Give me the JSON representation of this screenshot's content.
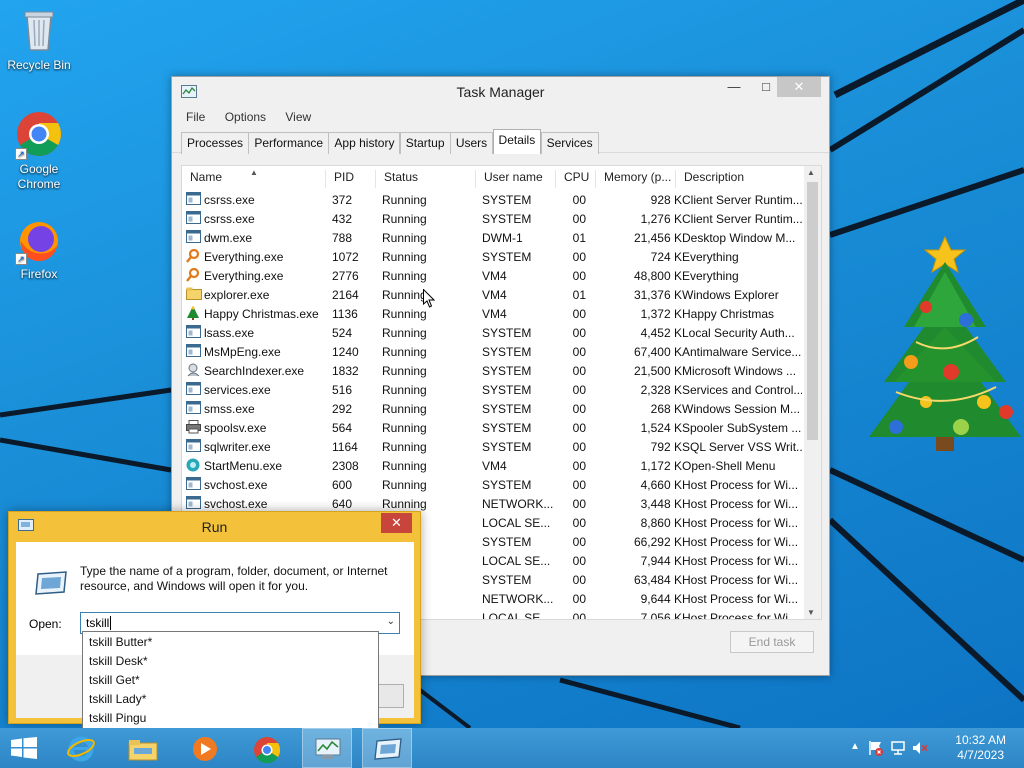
{
  "desktop": {
    "icons": [
      {
        "label": "Recycle Bin",
        "icon": "recycle-bin-icon"
      },
      {
        "label": "Google Chrome",
        "icon": "chrome-icon"
      },
      {
        "label": "Firefox",
        "icon": "firefox-icon"
      }
    ]
  },
  "task_manager": {
    "title": "Task Manager",
    "menu": [
      "File",
      "Options",
      "View"
    ],
    "tabs": [
      "Processes",
      "Performance",
      "App history",
      "Startup",
      "Users",
      "Details",
      "Services"
    ],
    "active_tab": "Details",
    "columns": [
      "Name",
      "PID",
      "Status",
      "User name",
      "CPU",
      "Memory (p...",
      "Description"
    ],
    "rows": [
      {
        "name": "csrss.exe",
        "pid": "372",
        "status": "Running",
        "user": "SYSTEM",
        "cpu": "00",
        "mem": "928 K",
        "desc": "Client Server Runtim..."
      },
      {
        "name": "csrss.exe",
        "pid": "432",
        "status": "Running",
        "user": "SYSTEM",
        "cpu": "00",
        "mem": "1,276 K",
        "desc": "Client Server Runtim..."
      },
      {
        "name": "dwm.exe",
        "pid": "788",
        "status": "Running",
        "user": "DWM-1",
        "cpu": "01",
        "mem": "21,456 K",
        "desc": "Desktop Window M..."
      },
      {
        "name": "Everything.exe",
        "pid": "1072",
        "status": "Running",
        "user": "SYSTEM",
        "cpu": "00",
        "mem": "724 K",
        "desc": "Everything"
      },
      {
        "name": "Everything.exe",
        "pid": "2776",
        "status": "Running",
        "user": "VM4",
        "cpu": "00",
        "mem": "48,800 K",
        "desc": "Everything"
      },
      {
        "name": "explorer.exe",
        "pid": "2164",
        "status": "Running",
        "user": "VM4",
        "cpu": "01",
        "mem": "31,376 K",
        "desc": "Windows Explorer"
      },
      {
        "name": "Happy Christmas.exe",
        "pid": "1136",
        "status": "Running",
        "user": "VM4",
        "cpu": "00",
        "mem": "1,372 K",
        "desc": "Happy Christmas"
      },
      {
        "name": "lsass.exe",
        "pid": "524",
        "status": "Running",
        "user": "SYSTEM",
        "cpu": "00",
        "mem": "4,452 K",
        "desc": "Local Security Auth..."
      },
      {
        "name": "MsMpEng.exe",
        "pid": "1240",
        "status": "Running",
        "user": "SYSTEM",
        "cpu": "00",
        "mem": "67,400 K",
        "desc": "Antimalware Service..."
      },
      {
        "name": "SearchIndexer.exe",
        "pid": "1832",
        "status": "Running",
        "user": "SYSTEM",
        "cpu": "00",
        "mem": "21,500 K",
        "desc": "Microsoft Windows ..."
      },
      {
        "name": "services.exe",
        "pid": "516",
        "status": "Running",
        "user": "SYSTEM",
        "cpu": "00",
        "mem": "2,328 K",
        "desc": "Services and Control..."
      },
      {
        "name": "smss.exe",
        "pid": "292",
        "status": "Running",
        "user": "SYSTEM",
        "cpu": "00",
        "mem": "268 K",
        "desc": "Windows Session M..."
      },
      {
        "name": "spoolsv.exe",
        "pid": "564",
        "status": "Running",
        "user": "SYSTEM",
        "cpu": "00",
        "mem": "1,524 K",
        "desc": "Spooler SubSystem ..."
      },
      {
        "name": "sqlwriter.exe",
        "pid": "1164",
        "status": "Running",
        "user": "SYSTEM",
        "cpu": "00",
        "mem": "792 K",
        "desc": "SQL Server VSS Writ..."
      },
      {
        "name": "StartMenu.exe",
        "pid": "2308",
        "status": "Running",
        "user": "VM4",
        "cpu": "00",
        "mem": "1,172 K",
        "desc": "Open-Shell Menu"
      },
      {
        "name": "svchost.exe",
        "pid": "600",
        "status": "Running",
        "user": "SYSTEM",
        "cpu": "00",
        "mem": "4,660 K",
        "desc": "Host Process for Wi..."
      },
      {
        "name": "svchost.exe",
        "pid": "640",
        "status": "Running",
        "user": "NETWORK...",
        "cpu": "00",
        "mem": "3,448 K",
        "desc": "Host Process for Wi..."
      },
      {
        "name": "",
        "pid": "",
        "status": "ning",
        "user": "LOCAL SE...",
        "cpu": "00",
        "mem": "8,860 K",
        "desc": "Host Process for Wi..."
      },
      {
        "name": "",
        "pid": "",
        "status": "ning",
        "user": "SYSTEM",
        "cpu": "00",
        "mem": "66,292 K",
        "desc": "Host Process for Wi..."
      },
      {
        "name": "",
        "pid": "",
        "status": "ning",
        "user": "LOCAL SE...",
        "cpu": "00",
        "mem": "7,944 K",
        "desc": "Host Process for Wi..."
      },
      {
        "name": "",
        "pid": "",
        "status": "ning",
        "user": "SYSTEM",
        "cpu": "00",
        "mem": "63,484 K",
        "desc": "Host Process for Wi..."
      },
      {
        "name": "",
        "pid": "",
        "status": "ning",
        "user": "NETWORK...",
        "cpu": "00",
        "mem": "9,644 K",
        "desc": "Host Process for Wi..."
      },
      {
        "name": "",
        "pid": "",
        "status": "ning",
        "user": "LOCAL SE...",
        "cpu": "00",
        "mem": "7,056 K",
        "desc": "Host Process for Wi..."
      }
    ],
    "end_task": "End task"
  },
  "run_dialog": {
    "title": "Run",
    "prompt": "Type the name of a program, folder, document, or Internet resource, and Windows will open it for you.",
    "open_label": "Open:",
    "input_value": "tskill",
    "suggestions": [
      "tskill Butter*",
      "tskill Desk*",
      "tskill Get*",
      "tskill Lady*",
      "tskill Pingu"
    ]
  },
  "taskbar": {
    "clock_time": "10:32 AM",
    "clock_date": "4/7/2023"
  }
}
